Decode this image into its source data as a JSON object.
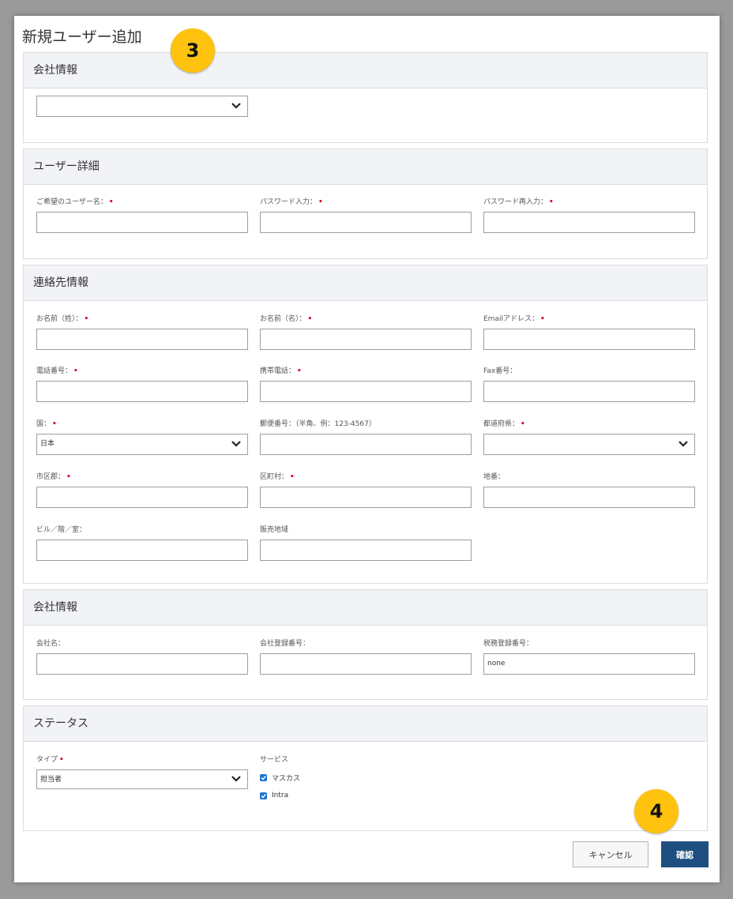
{
  "page_title": "新規ユーザー追加",
  "step_badges": [
    "3",
    "4"
  ],
  "sections": {
    "company_select": {
      "title": "会社情報",
      "select_value": ""
    },
    "user_detail": {
      "title": "ユーザー詳細",
      "username_label": "ご希望のユーザー名：",
      "password_label": "パスワード入力：",
      "password_confirm_label": "パスワード再入力："
    },
    "contact": {
      "title": "連絡先情報",
      "last_name_label": "お名前（姓）：",
      "first_name_label": "お名前（名）：",
      "email_label": "Emailアドレス：",
      "phone_label": "電話番号：",
      "mobile_label": "携帯電話：",
      "fax_label": "Fax番号：",
      "country_label": "国：",
      "country_value": "日本",
      "postal_label": "郵便番号：（半角、例：123-4567）",
      "prefecture_label": "都道府県：",
      "city_label": "市区郡：",
      "town_label": "区町村：",
      "address_label": "地番：",
      "building_label": "ビル／階／室：",
      "sales_region_label": "販売地域"
    },
    "company_info": {
      "title": "会社情報",
      "company_name_label": "会社名：",
      "company_reg_label": "会社登録番号：",
      "tax_reg_label": "税務登録番号：",
      "tax_reg_value": "none"
    },
    "status": {
      "title": "ステータス",
      "type_label": "タイプ",
      "type_value": "担当者",
      "service_label": "サービス",
      "services": [
        "マスカス",
        "Intra"
      ]
    }
  },
  "buttons": {
    "cancel": "キャンセル",
    "confirm": "確認"
  },
  "colors": {
    "badge": "#FFC20E",
    "confirm_button": "#1f4f80",
    "required": "#d0021b",
    "checkbox": "#1e74d0"
  }
}
